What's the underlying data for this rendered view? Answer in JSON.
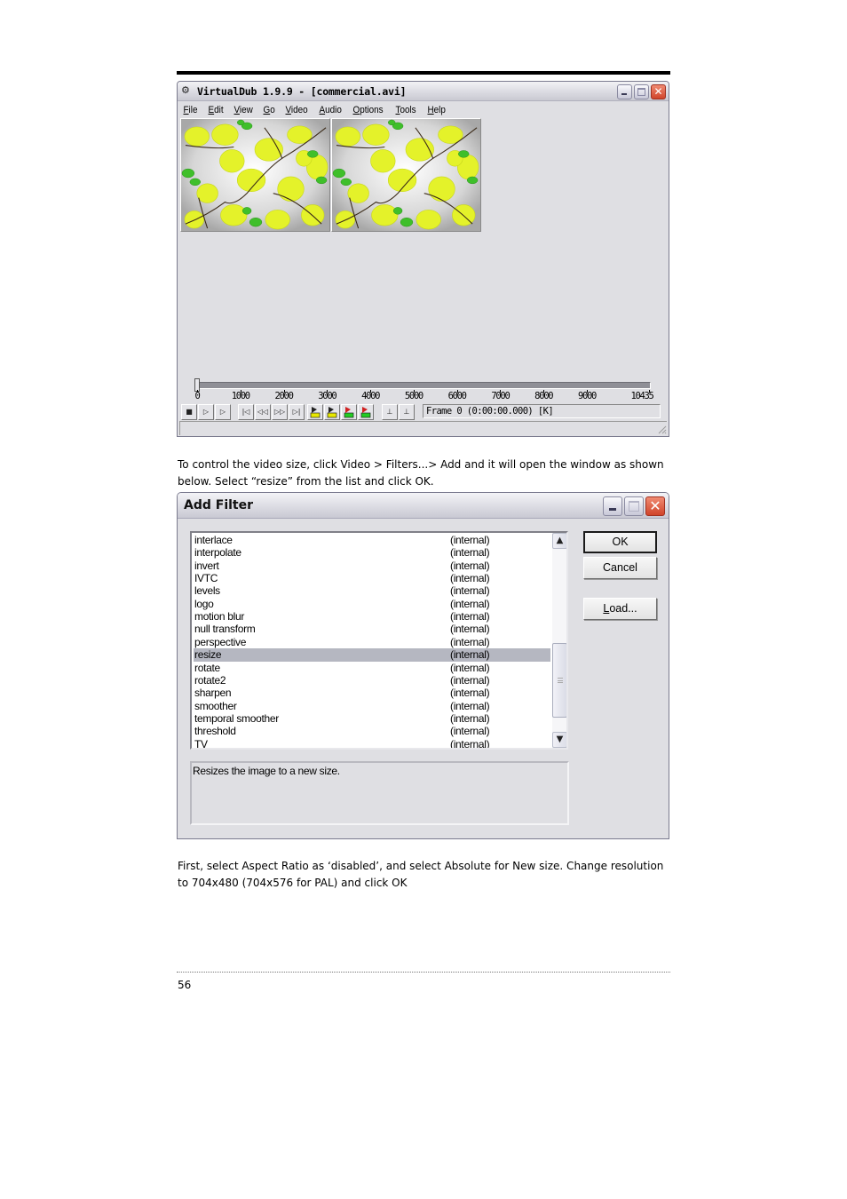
{
  "virtualdub": {
    "title": "VirtualDub 1.9.9 - [commercial.avi]",
    "menu": [
      {
        "label": "File",
        "accel": "F",
        "rest": "ile"
      },
      {
        "label": "Edit",
        "accel": "E",
        "rest": "dit"
      },
      {
        "label": "View",
        "accel": "V",
        "rest": "iew"
      },
      {
        "label": "Go",
        "accel": "G",
        "rest": "o"
      },
      {
        "label": "Video",
        "accel": "V",
        "rest": "ideo"
      },
      {
        "label": "Audio",
        "accel": "A",
        "rest": "udio"
      },
      {
        "label": "Options",
        "accel": "O",
        "rest": "ptions"
      },
      {
        "label": "Tools",
        "accel": "T",
        "rest": "ools"
      },
      {
        "label": "Help",
        "accel": "H",
        "rest": "elp"
      }
    ],
    "timeline": {
      "ticks": [
        "0",
        "1000",
        "2000",
        "3000",
        "4000",
        "5000",
        "6000",
        "7000",
        "8000",
        "9000",
        "10435"
      ],
      "max_frame": 10435,
      "current_frame": 0
    },
    "toolbar_buttons": [
      {
        "name": "stop",
        "icon": "stop-icon"
      },
      {
        "name": "play-input",
        "icon": "play-input-icon"
      },
      {
        "name": "play-output",
        "icon": "play-output-icon"
      },
      {
        "name": "go-start",
        "icon": "go-start-icon"
      },
      {
        "name": "back",
        "icon": "rewind-icon"
      },
      {
        "name": "forward",
        "icon": "fast-forward-icon"
      },
      {
        "name": "go-end",
        "icon": "go-end-icon"
      },
      {
        "name": "prev-keyframe",
        "icon": "prev-keyframe-icon"
      },
      {
        "name": "next-keyframe",
        "icon": "next-keyframe-icon"
      },
      {
        "name": "prev-scene",
        "icon": "prev-scene-icon"
      },
      {
        "name": "next-scene",
        "icon": "next-scene-icon"
      },
      {
        "name": "mark-in",
        "icon": "mark-in-icon"
      },
      {
        "name": "mark-out",
        "icon": "mark-out-icon"
      }
    ],
    "frame_status": "Frame 0 (0:00:00.000) [K]"
  },
  "text": {
    "para1": "To control the video size, click Video > Filters...> Add and it will open the window as shown below. Select “resize” from the list and click OK.",
    "para2": "First, select Aspect Ratio as ‘disabled’, and select Absolute for New size. Change resolution to 704x480 (704x576 for PAL) and click OK",
    "page_number": "56"
  },
  "add_filter": {
    "title": "Add Filter",
    "filters": [
      {
        "name": "interlace",
        "source": "(internal)"
      },
      {
        "name": "interpolate",
        "source": "(internal)"
      },
      {
        "name": "invert",
        "source": "(internal)"
      },
      {
        "name": "IVTC",
        "source": "(internal)"
      },
      {
        "name": "levels",
        "source": "(internal)"
      },
      {
        "name": "logo",
        "source": "(internal)"
      },
      {
        "name": "motion blur",
        "source": "(internal)"
      },
      {
        "name": "null transform",
        "source": "(internal)"
      },
      {
        "name": "perspective",
        "source": "(internal)"
      },
      {
        "name": "resize",
        "source": "(internal)",
        "selected": true
      },
      {
        "name": "rotate",
        "source": "(internal)"
      },
      {
        "name": "rotate2",
        "source": "(internal)"
      },
      {
        "name": "sharpen",
        "source": "(internal)"
      },
      {
        "name": "smoother",
        "source": "(internal)"
      },
      {
        "name": "temporal smoother",
        "source": "(internal)"
      },
      {
        "name": "threshold",
        "source": "(internal)"
      },
      {
        "name": "TV",
        "source": "(internal)"
      }
    ],
    "ok_label": "OK",
    "cancel_label": "Cancel",
    "load_label": {
      "accel": "L",
      "rest": "oad..."
    },
    "description": "Resizes the image to a new size.",
    "colors": {
      "selection": "#b5b7c1"
    }
  }
}
